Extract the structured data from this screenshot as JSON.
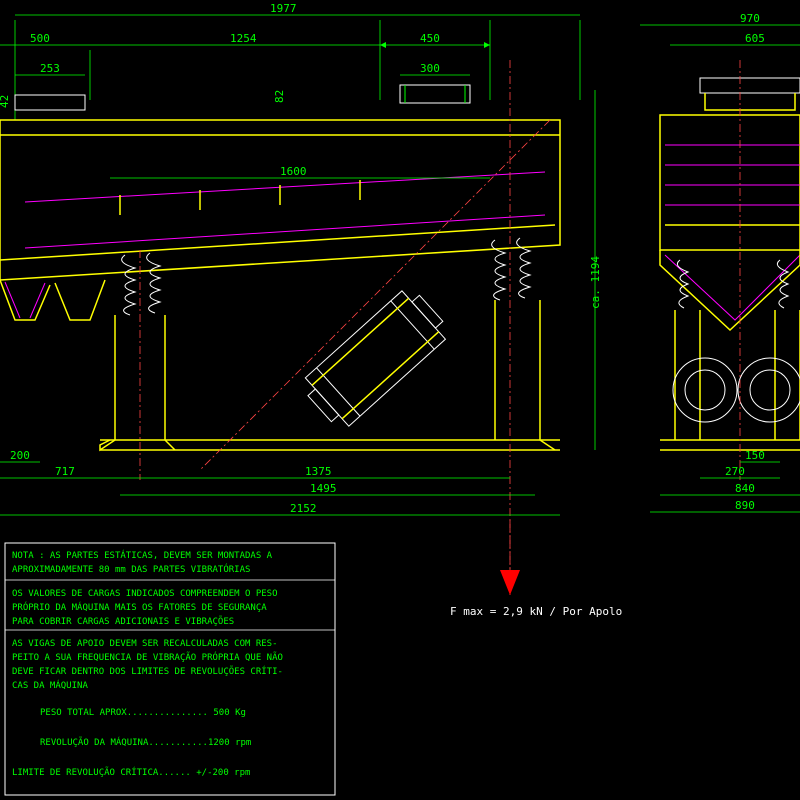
{
  "dimensions": {
    "top_overall": "1977",
    "top_left": "500",
    "top_center": "1254",
    "top_right_slot": "450",
    "sub_left": "253",
    "sub_left_h": "42",
    "sub_center_h": "82",
    "sub_right": "300",
    "mid_span": "1600",
    "bottom_left": "717",
    "bottom_left_small": "200",
    "bottom_center": "1375",
    "bottom_subframe": "1495",
    "bottom_overall": "2152",
    "height_label": "ca. 1194",
    "right_top": "970",
    "right_top2": "605",
    "right_bot1": "150",
    "right_bot2": "270",
    "right_bot3": "840",
    "right_bot4": "890"
  },
  "force": {
    "label": "F max = 2,9 kN / Por Apolo"
  },
  "notes": {
    "n1a": "NOTA : AS PARTES ESTÁTICAS, DEVEM SER MONTADAS A",
    "n1b": "APROXIMADAMENTE 80 mm DAS PARTES VIBRATÓRIAS",
    "n2a": "OS VALORES DE CARGAS INDICADOS COMPREENDEM O PESO",
    "n2b": "PRÓPRIO DA MÁQUINA MAIS OS FATORES DE SEGURANÇA",
    "n2c": "PARA COBRIR CARGAS ADICIONAIS E VIBRAÇÕES",
    "n3a": "AS VIGAS DE APOIO DEVEM SER RECALCULADAS COM RES-",
    "n3b": "PEITO A SUA FREQUENCIA DE VIBRAÇÃO PRÓPRIA QUE NÃO",
    "n3c": "DEVE FICAR DENTRO DOS LIMITES DE REVOLUÇÕES CRÍTI-",
    "n3d": "CAS DA MÁQUINA",
    "weight": "PESO TOTAL APROX............... 500 Kg",
    "rpm": "REVOLUÇÃO DA MÁQUINA...........1200 rpm",
    "critical": "LIMITE DE REVOLUÇÃO CRÍTICA...... +/-200 rpm"
  }
}
